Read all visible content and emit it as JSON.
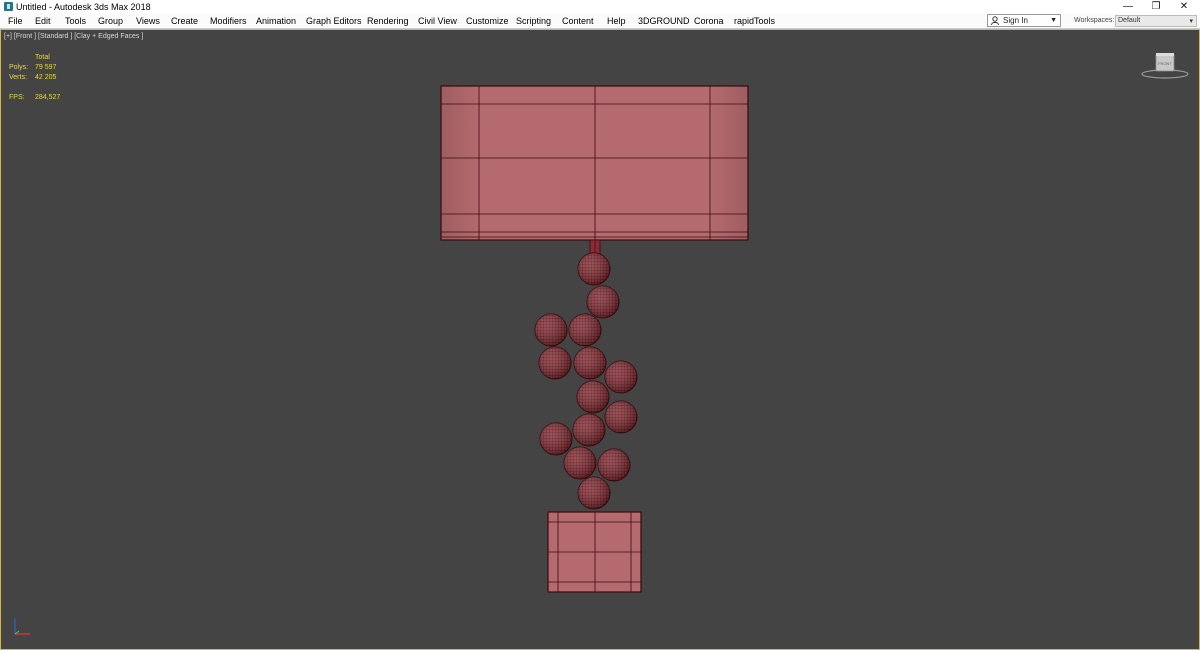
{
  "window": {
    "title": "Untitled - Autodesk 3ds Max 2018",
    "controls": {
      "minimize": "—",
      "restore": "❐",
      "close": "✕"
    }
  },
  "menu": {
    "items": [
      "File",
      "Edit",
      "Tools",
      "Group",
      "Views",
      "Create",
      "Modifiers",
      "Animation",
      "Graph Editors",
      "Rendering",
      "Civil View",
      "Customize",
      "Scripting",
      "Content",
      "Help",
      "3DGROUND",
      "Corona",
      "rapidTools"
    ],
    "sign_in": "Sign In",
    "workspaces_label": "Workspaces:",
    "workspace_value": "Default"
  },
  "viewport": {
    "label": "[+] [Front ] [Standard ] [Clay + Edged Faces ]",
    "stats": {
      "total_label": "Total",
      "polys_label": "Polys:",
      "polys_value": "79 597",
      "verts_label": "Verts:",
      "verts_value": "42 205",
      "fps_label": "FPS:",
      "fps_value": "284,527"
    },
    "viewcube_label": "FRONT",
    "colors": {
      "background": "#444444",
      "mesh_fill": "#b46a6e",
      "mesh_edge": "#3a0a0e",
      "sphere_fill": "#8a2a32",
      "stat_text": "#e8d840",
      "active_border": "#d9b64a"
    }
  }
}
